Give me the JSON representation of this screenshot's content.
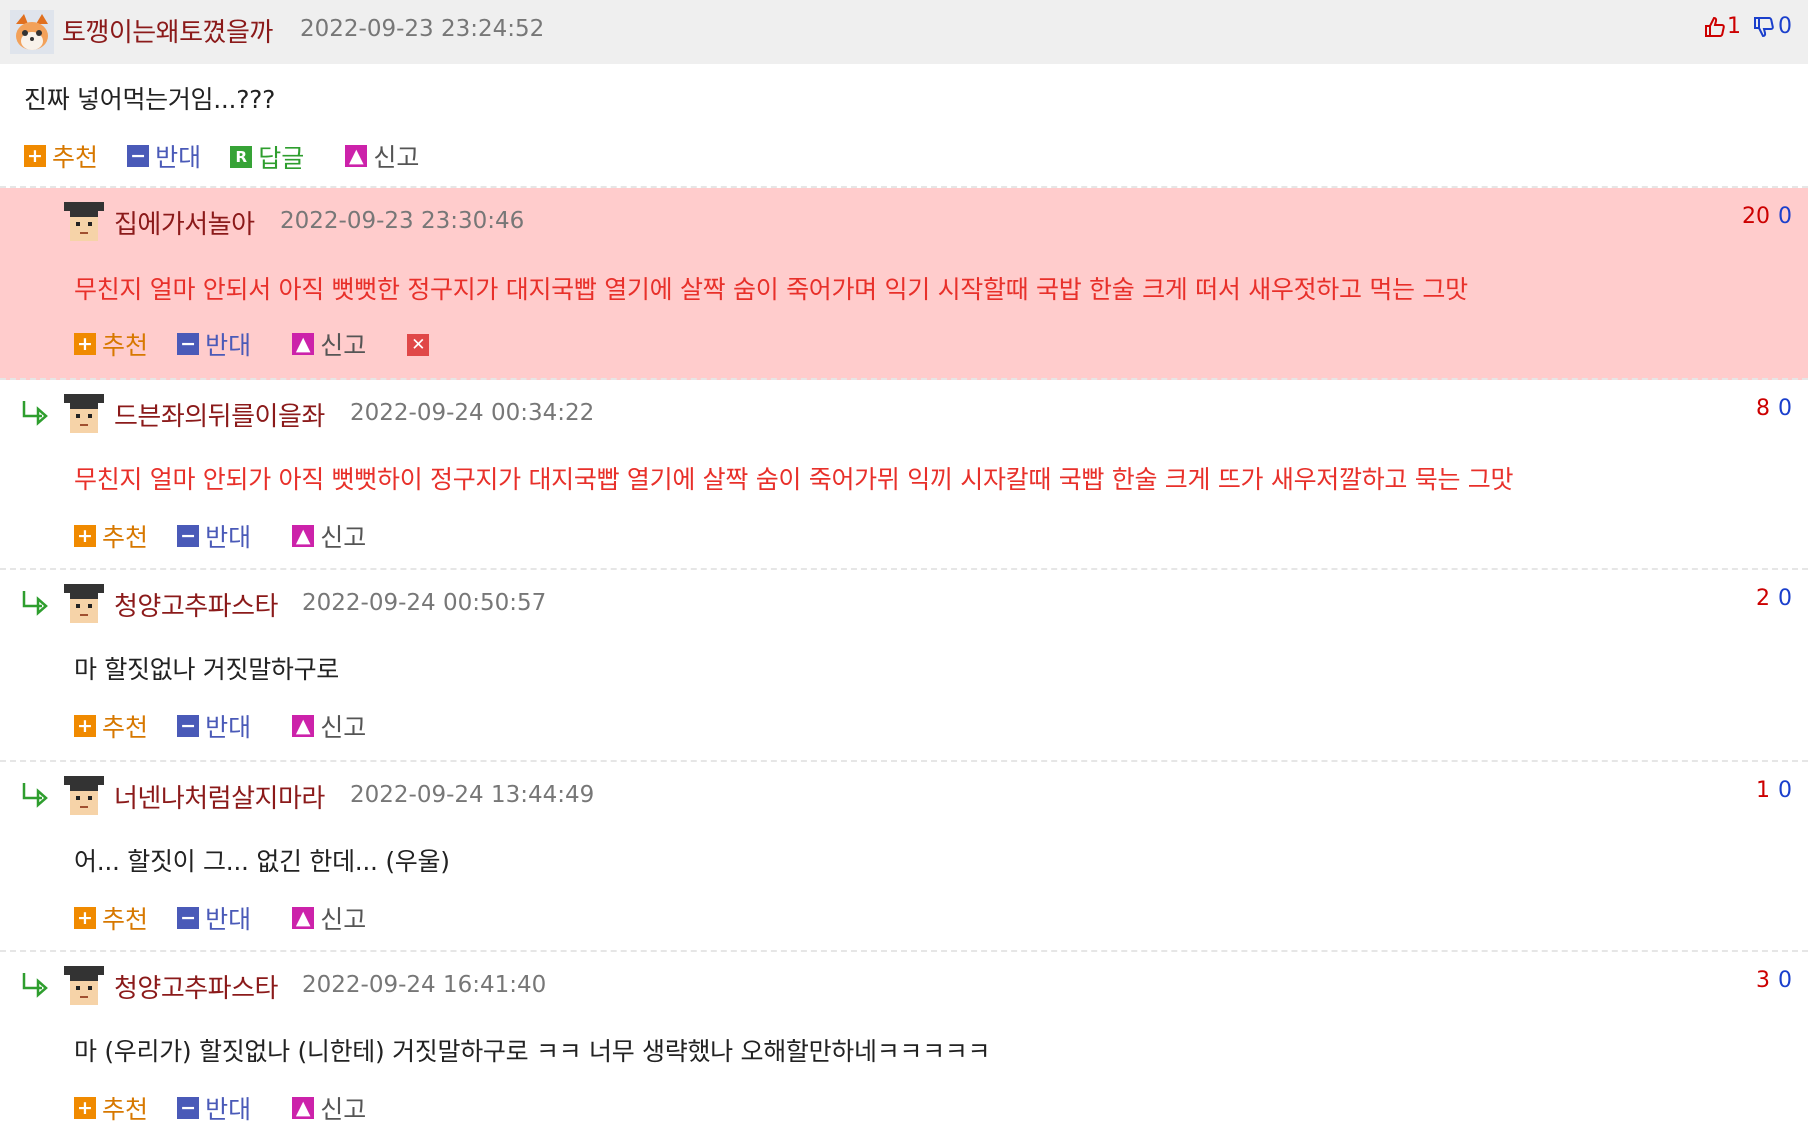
{
  "main_comment": {
    "nick": "토깽이는왜토꼈을까",
    "date": "2022-09-23 23:24:52",
    "up": "1",
    "down": "0",
    "text": "진짜 넣어먹는거임...???",
    "actions": {
      "recommend": "추천",
      "oppose": "반대",
      "reply": "답글",
      "report": "신고"
    }
  },
  "replies": [
    {
      "nick": "집에가서놀아",
      "date": "2022-09-23 23:30:46",
      "up": "20",
      "down": "0",
      "text": "무친지 얼마 안되서 아직 뻣뻣한 정구지가 대지국빱 열기에 살짝 숨이 죽어가며 익기 시작할때 국밥 한술 크게 떠서 새우젓하고 먹는 그맛"
    },
    {
      "nick": "드븐좌의뒤를이을좌",
      "date": "2022-09-24 00:34:22",
      "up": "8",
      "down": "0",
      "text": "무친지 얼마 안되가 아직 뻣뻣하이 정구지가 대지국빱 열기에 살짝 숨이 죽어가뮈 익끼 시자칼때 국빱 한술 크게 뜨가 새우저깔하고 묵는 그맛"
    },
    {
      "nick": "청양고추파스타",
      "date": "2022-09-24 00:50:57",
      "up": "2",
      "down": "0",
      "text": "마 할짓없나 거짓말하구로"
    },
    {
      "nick": "너넨나처럼살지마라",
      "date": "2022-09-24 13:44:49",
      "up": "1",
      "down": "0",
      "text": "어... 할짓이 그... 없긴 한데... (우울)"
    },
    {
      "nick": "청양고추파스타",
      "date": "2022-09-24 16:41:40",
      "up": "3",
      "down": "0",
      "text": "마 (우리가) 할짓없나 (니한테) 거짓말하구로 ㅋㅋ 너무 생략했나 오해할만하네ㅋㅋㅋㅋㅋ"
    }
  ],
  "labels": {
    "recommend": "추천",
    "oppose": "반대",
    "report": "신고"
  },
  "colors": {
    "nick": "#8b1a1a",
    "highlight_bg": "#ffcccc",
    "red_text": "#e8302a",
    "recommend": "#f08a00",
    "oppose": "#4a5ab8",
    "reply": "#36a336",
    "report": "#cc22aa",
    "delete": "#e04848"
  },
  "icons": {
    "thumb_up": "thumb-up-icon",
    "thumb_down": "thumb-down-icon",
    "reply_arrow": "reply-arrow-icon",
    "avatar": "avatar-icon",
    "delete": "close-icon"
  }
}
